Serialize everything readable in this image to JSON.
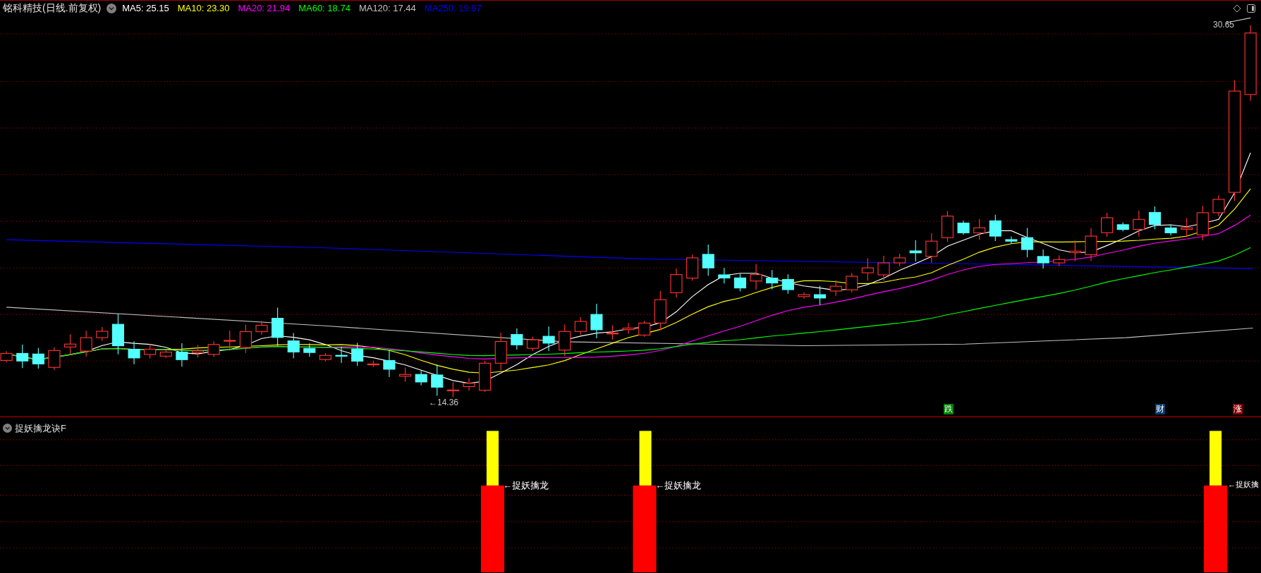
{
  "header": {
    "title": "铭科精技(日线.前复权)",
    "indicators": [
      {
        "label": "MA5: 25.15",
        "color": "#ffffff"
      },
      {
        "label": "MA10: 23.30",
        "color": "#ffff00"
      },
      {
        "label": "MA20: 21.94",
        "color": "#ff00ff"
      },
      {
        "label": "MA60: 18.74",
        "color": "#00ff00"
      },
      {
        "label": "MA120: 17.44",
        "color": "#c0c0c0"
      },
      {
        "label": "MA250: 19.97",
        "color": "#0000ff"
      }
    ]
  },
  "price_labels": {
    "high": "30.65",
    "low": "←14.36"
  },
  "event_markers": [
    {
      "label": "跌",
      "color": "#008000"
    },
    {
      "label": "财",
      "color": "#0a3a6e"
    },
    {
      "label": "涨",
      "color": "#8b0000"
    }
  ],
  "indicator_panel": {
    "title": "捉妖擒龙诀F",
    "signals": [
      {
        "label": "←捉妖擒龙"
      },
      {
        "label": "←捉妖擒龙"
      },
      {
        "label": "←捉妖擒"
      }
    ]
  }
}
